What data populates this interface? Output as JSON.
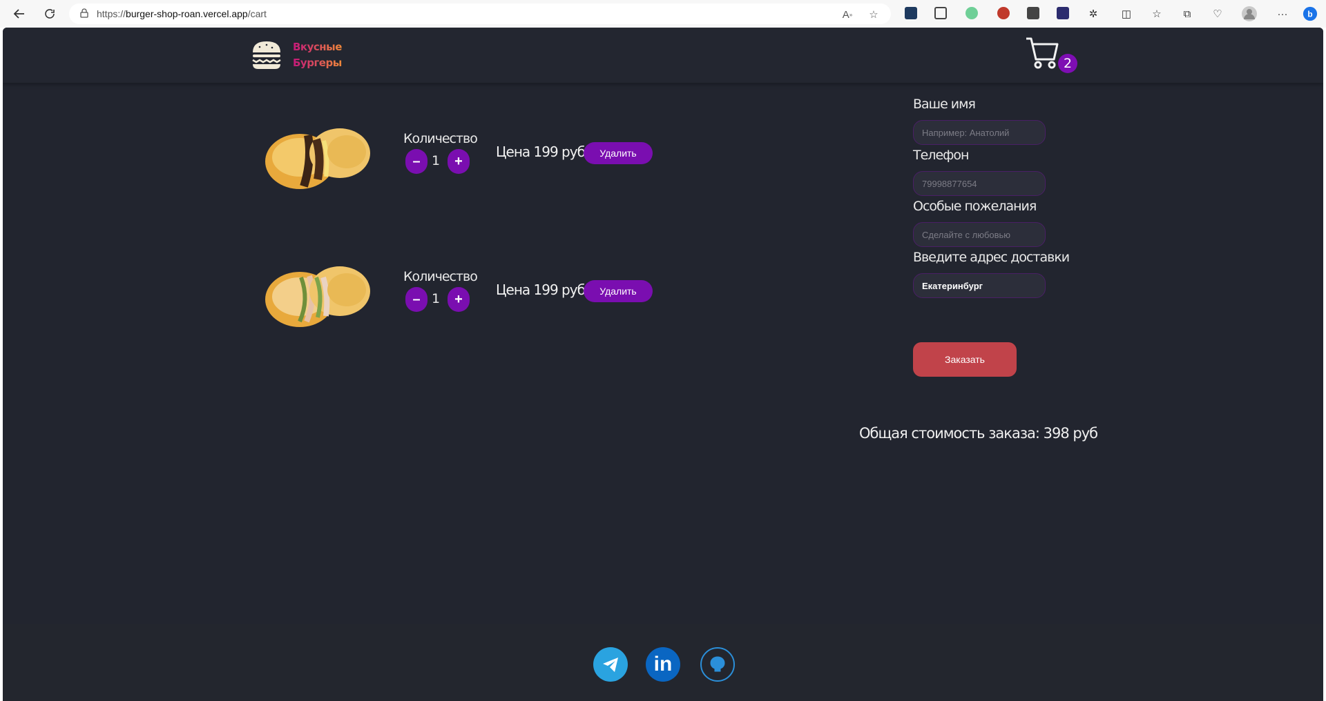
{
  "browser": {
    "url_prefix": "https://",
    "url_host": "burger-shop-roan.vercel.app",
    "url_path": "/cart"
  },
  "header": {
    "logo_line1": "Вкусные",
    "logo_line2": "Бургеры",
    "cart_count": "2"
  },
  "cart": {
    "items": [
      {
        "qty_label": "Количество",
        "qty": "1",
        "price": "Цена 199 руб.",
        "remove_label": "Удалить",
        "minus": "–",
        "plus": "+"
      },
      {
        "qty_label": "Количество",
        "qty": "1",
        "price": "Цена 199 руб.",
        "remove_label": "Удалить",
        "minus": "–",
        "plus": "+"
      }
    ]
  },
  "form": {
    "name_label": "Ваше имя",
    "name_placeholder": "Например: Анатолий",
    "phone_label": "Телефон",
    "phone_placeholder": "79998877654",
    "wishes_label": "Особые пожелания",
    "wishes_placeholder": "Сделайте с любовью",
    "address_label": "Введите адрес доставки",
    "address_value": "Екатеринбург",
    "order_label": "Заказать"
  },
  "total": "Общая стоимость заказа: 398 руб",
  "footer": {
    "icons": [
      "telegram-icon",
      "linkedin-icon",
      "github-icon"
    ],
    "linkedin_text": "in"
  },
  "colors": {
    "background": "#22252f",
    "accent_purple": "#7a0eb0",
    "order_red": "#c1434a"
  }
}
